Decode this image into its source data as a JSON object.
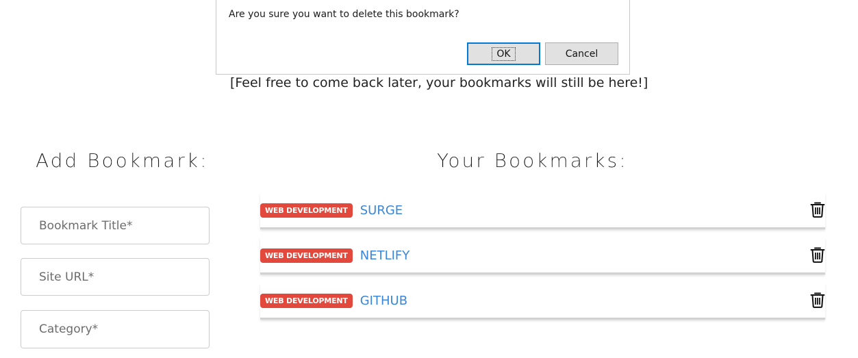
{
  "dialog": {
    "message": "Are you sure you want to delete this bookmark?",
    "ok_label": "OK",
    "cancel_label": "Cancel"
  },
  "tagline": "[Feel free to come back later, your bookmarks will still be here!]",
  "add_section": {
    "heading": "Add Bookmark:",
    "fields": {
      "title_placeholder": "Bookmark Title*",
      "url_placeholder": "Site URL*",
      "category_placeholder": "Category*"
    }
  },
  "bookmarks_section": {
    "heading": "Your Bookmarks:",
    "items": [
      {
        "category": "WEB DEVELOPMENT",
        "title": "SURGE",
        "delete_icon": "trash-icon"
      },
      {
        "category": "WEB DEVELOPMENT",
        "title": "NETLIFY",
        "delete_icon": "trash-icon"
      },
      {
        "category": "WEB DEVELOPMENT",
        "title": "GITHUB",
        "delete_icon": "trash-icon"
      }
    ]
  },
  "colors": {
    "badge_bg": "#e2493c",
    "link": "#3a86d8",
    "ok_focus_border": "#0078d7"
  }
}
